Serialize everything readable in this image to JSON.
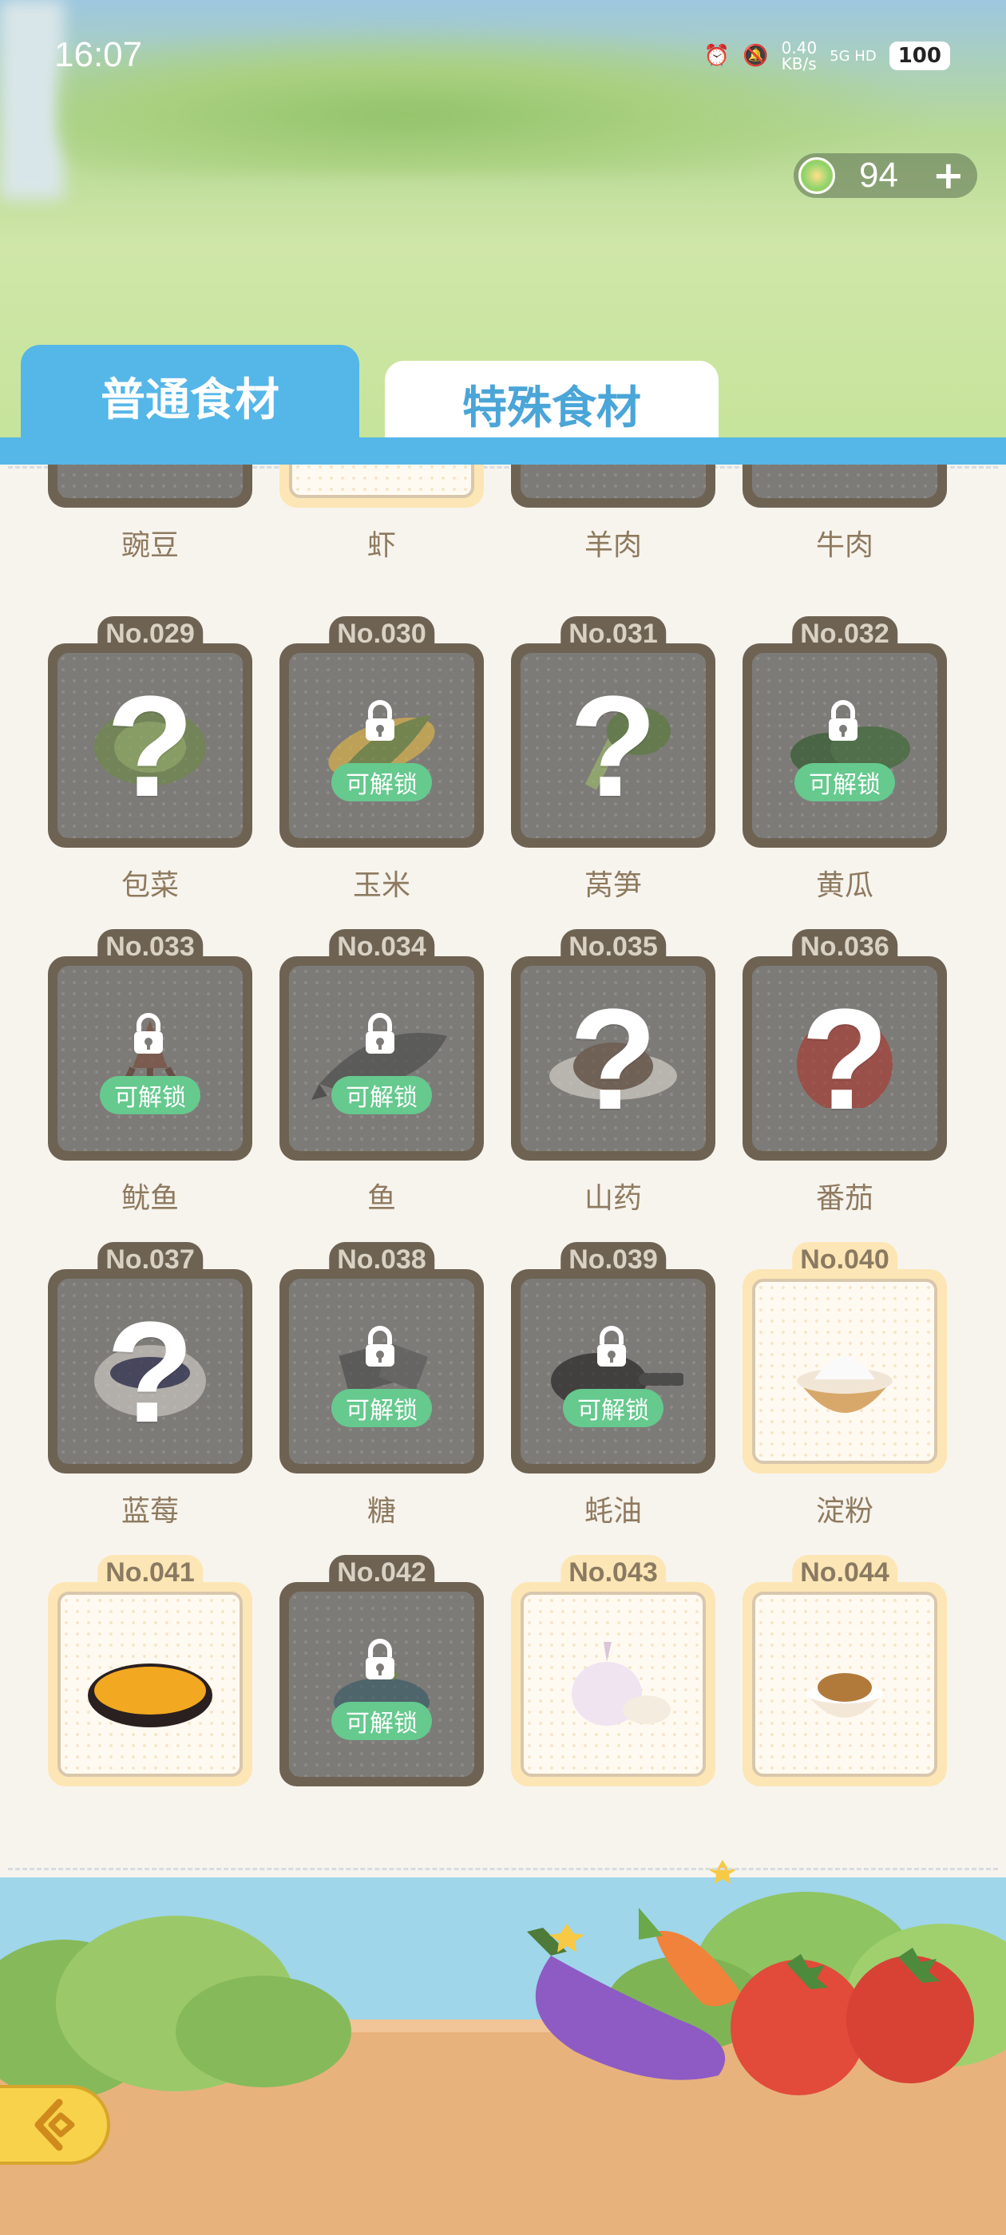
{
  "status_bar": {
    "time": "16:07",
    "net_speed": "0.40\nKB/s",
    "net_type": "5G HD",
    "battery": "100"
  },
  "currency": {
    "amount": "94",
    "plus_icon": "plus-icon",
    "coin_icon": "coin-icon"
  },
  "tabs": [
    {
      "label": "普通食材",
      "active": true
    },
    {
      "label": "特殊食材",
      "active": false
    }
  ],
  "partial_row_names": [
    "豌豆",
    "虾",
    "羊肉",
    "牛肉"
  ],
  "ingredients": [
    {
      "no": "No.029",
      "name": "包菜",
      "state": "unknown"
    },
    {
      "no": "No.030",
      "name": "玉米",
      "state": "unlockable"
    },
    {
      "no": "No.031",
      "name": "莴笋",
      "state": "unknown"
    },
    {
      "no": "No.032",
      "name": "黄瓜",
      "state": "unlockable"
    },
    {
      "no": "No.033",
      "name": "鱿鱼",
      "state": "unlockable"
    },
    {
      "no": "No.034",
      "name": "鱼",
      "state": "unlockable"
    },
    {
      "no": "No.035",
      "name": "山药",
      "state": "unknown"
    },
    {
      "no": "No.036",
      "name": "番茄",
      "state": "unknown"
    },
    {
      "no": "No.037",
      "name": "蓝莓",
      "state": "unknown"
    },
    {
      "no": "No.038",
      "name": "糖",
      "state": "unlockable"
    },
    {
      "no": "No.039",
      "name": "蚝油",
      "state": "unlockable"
    },
    {
      "no": "No.040",
      "name": "淀粉",
      "state": "unlocked"
    },
    {
      "no": "No.041",
      "name": "",
      "state": "unlocked"
    },
    {
      "no": "No.042",
      "name": "",
      "state": "unlockable"
    },
    {
      "no": "No.043",
      "name": "",
      "state": "unlocked"
    },
    {
      "no": "No.044",
      "name": "",
      "state": "unlocked"
    }
  ],
  "unlock_label": "可解锁",
  "unknown_mark": "?",
  "colors": {
    "tab_blue": "#55b6e8",
    "unlock_green": "#66c98e",
    "locked_frame": "#6e6353",
    "unlocked_frame": "#fde6b5"
  }
}
